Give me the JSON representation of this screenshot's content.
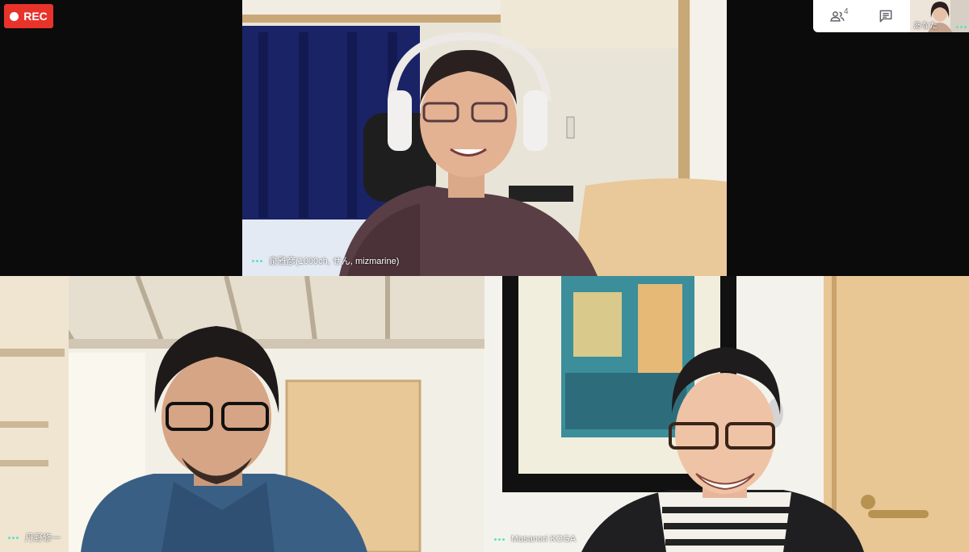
{
  "recording": {
    "label": "REC",
    "color": "#e8332b"
  },
  "toolbar": {
    "participants_icon": "people-icon",
    "participants_count": "4",
    "chat_icon": "chat-icon",
    "self_label": "あなた"
  },
  "participants": [
    {
      "name": "泉雅彦(1000ch, せん, mizmarine)"
    },
    {
      "name": "丹野修一"
    },
    {
      "name": "Masanori KOGA"
    }
  ],
  "colors": {
    "speaking_dots": "#5fe0c6"
  }
}
